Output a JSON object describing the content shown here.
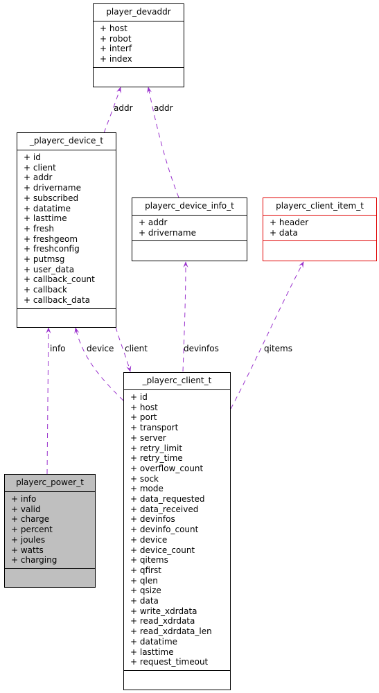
{
  "diagram": {
    "type": "collaboration",
    "nodes": {
      "player_devaddr": {
        "title": "player_devaddr",
        "attrs": [
          "+ host",
          "+ robot",
          "+ interf",
          "+ index"
        ]
      },
      "playerc_device_t": {
        "title": "_playerc_device_t",
        "attrs": [
          "+ id",
          "+ client",
          "+ addr",
          "+ drivername",
          "+ subscribed",
          "+ datatime",
          "+ lasttime",
          "+ fresh",
          "+ freshgeom",
          "+ freshconfig",
          "+ putmsg",
          "+ user_data",
          "+ callback_count",
          "+ callback",
          "+ callback_data"
        ]
      },
      "playerc_device_info_t": {
        "title": "playerc_device_info_t",
        "attrs": [
          "+ addr",
          "+ drivername"
        ]
      },
      "playerc_client_item_t": {
        "title": "playerc_client_item_t",
        "attrs": [
          "+ header",
          "+ data"
        ],
        "border_color": "#e00000"
      },
      "playerc_power_t": {
        "title": "playerc_power_t",
        "attrs": [
          "+ info",
          "+ valid",
          "+ charge",
          "+ percent",
          "+ joules",
          "+ watts",
          "+ charging"
        ],
        "fill_color": "#bfbfbf"
      },
      "playerc_client_t": {
        "title": "_playerc_client_t",
        "attrs": [
          "+ id",
          "+ host",
          "+ port",
          "+ transport",
          "+ server",
          "+ retry_limit",
          "+ retry_time",
          "+ overflow_count",
          "+ sock",
          "+ mode",
          "+ data_requested",
          "+ data_received",
          "+ devinfos",
          "+ devinfo_count",
          "+ device",
          "+ device_count",
          "+ qitems",
          "+ qfirst",
          "+ qlen",
          "+ qsize",
          "+ data",
          "+ write_xdrdata",
          "+ read_xdrdata",
          "+ read_xdrdata_len",
          "+ datatime",
          "+ lasttime",
          "+ request_timeout"
        ]
      }
    },
    "edges": [
      {
        "from": "playerc_device_t",
        "to": "player_devaddr",
        "label": "addr"
      },
      {
        "from": "playerc_device_info_t",
        "to": "player_devaddr",
        "label": "addr"
      },
      {
        "from": "playerc_power_t",
        "to": "playerc_device_t",
        "label": "info"
      },
      {
        "from": "playerc_client_t",
        "to": "playerc_device_t",
        "label": "device"
      },
      {
        "from": "playerc_device_t",
        "to": "playerc_client_t",
        "label": "client"
      },
      {
        "from": "playerc_client_t",
        "to": "playerc_device_info_t",
        "label": "devinfos"
      },
      {
        "from": "playerc_client_t",
        "to": "playerc_client_item_t",
        "label": "qitems"
      }
    ],
    "edge_color": "#9a32cd"
  }
}
